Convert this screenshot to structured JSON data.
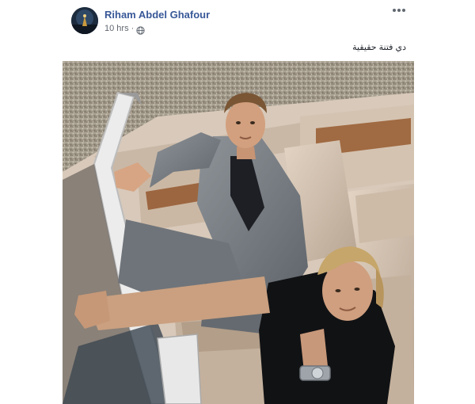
{
  "post": {
    "author_name": "Riham Abdel Ghafour",
    "timestamp": "10 hrs",
    "privacy_icon": "globe-icon",
    "more_icon": "more-options-icon",
    "text": "دي فتنة حقيقية"
  }
}
